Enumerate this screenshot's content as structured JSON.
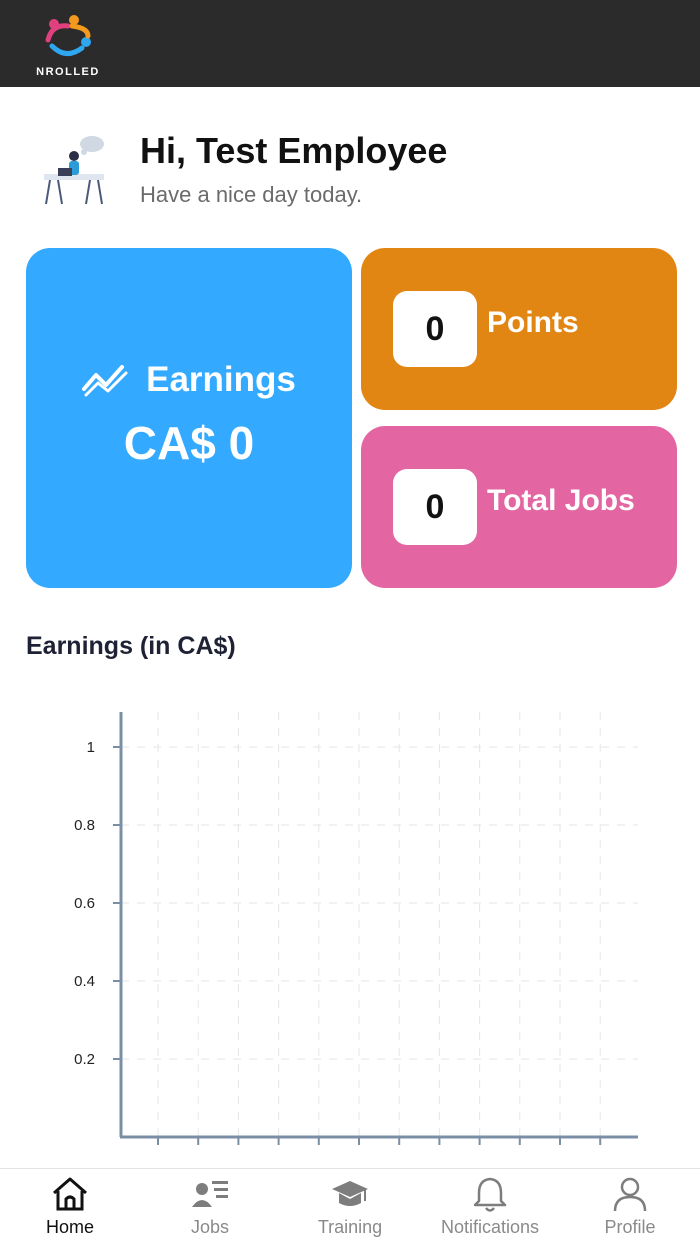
{
  "header": {
    "logo_text": "NROLLED",
    "logo_icon": "nrolled-logo-icon"
  },
  "greeting": {
    "title": "Hi, Test Employee",
    "subtitle": "Have a nice day today.",
    "avatar_icon": "desk-worker-illustration"
  },
  "cards": {
    "earnings": {
      "label": "Earnings",
      "value": "CA$ 0",
      "icon": "trend-up-icon",
      "color": "#33aaff"
    },
    "points": {
      "label": "Points",
      "value": "0",
      "color": "#e28613"
    },
    "total_jobs": {
      "label": "Total Jobs",
      "value": "0",
      "color": "#e366a2"
    }
  },
  "chart_section": {
    "title": "Earnings (in CA$)"
  },
  "chart_data": {
    "type": "line",
    "title": "Earnings (in CA$)",
    "xlabel": "",
    "ylabel": "",
    "ylim": [
      0,
      1
    ],
    "yticks": [
      "1",
      "0.8",
      "0.6",
      "0.4",
      "0.2"
    ],
    "categories": [
      "",
      "",
      "",
      "",
      "",
      "",
      "",
      "",
      "",
      "",
      "",
      ""
    ],
    "series": [],
    "grid": true,
    "legend": "none"
  },
  "bottom_nav": {
    "items": [
      {
        "label": "Home",
        "icon": "home-icon",
        "active": true
      },
      {
        "label": "Jobs",
        "icon": "jobs-list-icon",
        "active": false
      },
      {
        "label": "Training",
        "icon": "graduation-cap-icon",
        "active": false
      },
      {
        "label": "Notifications",
        "icon": "bell-icon",
        "active": false
      },
      {
        "label": "Profile",
        "icon": "user-icon",
        "active": false
      }
    ]
  }
}
